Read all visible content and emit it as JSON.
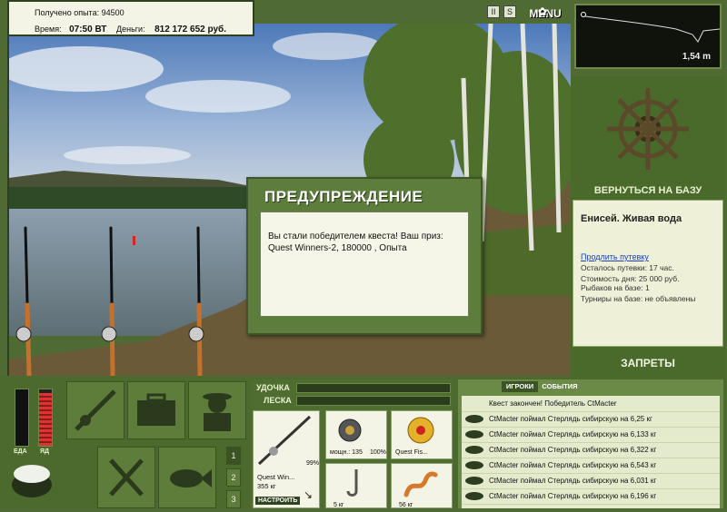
{
  "stats": {
    "xp_label": "Получено опыта:",
    "xp_value": "94500",
    "time_label": "Время:",
    "time_value": "07:50 ВТ",
    "money_label": "Деньги:",
    "money_value": "812 172 652 руб."
  },
  "topbar": {
    "pause_glyph": "II",
    "sound_glyph": "S",
    "menu_label": "MENU"
  },
  "depth": {
    "value": "1,54 m"
  },
  "right_panel": {
    "return_label": "ВЕРНУТЬСЯ НА БАЗУ",
    "location": "Енисей. Живая вода",
    "extend_link": "Продлить путевку",
    "info_lines": [
      "Осталось путевки: 17 час.",
      "Стоимость дня: 25 000 руб.",
      "Рыбаков на базе: 1",
      "Турниры на базе: не объявлены"
    ],
    "bans_label": "ЗАПРЕТЫ"
  },
  "dialog": {
    "title": "ПРЕДУПРЕЖДЕНИЕ",
    "message": "Вы стали победителем квеста! Ваш приз: Quest Winners-2, 180000 , Опыта"
  },
  "meters": {
    "food_label": "ЕДА",
    "poison_label": "ЯД"
  },
  "pages": [
    "1",
    "2",
    "3"
  ],
  "rod_panel": {
    "rod_label": "УДОЧКА",
    "line_label": "ЛЕСКА",
    "rod_name": "Quest Win...",
    "rod_weight": "355 кг",
    "rod_pct": "99%",
    "setup_label": "НАСТРОИТЬ",
    "reel_caption": "мощн.: 135",
    "reel_pct": "100%",
    "line_caption": "Quest Fis...",
    "hook_caption": "5 кг",
    "bait_caption": "56 кг"
  },
  "events": {
    "tab_players": "ИГРОКИ",
    "tab_events": "СОБЫТИЯ",
    "quest_done": "Квест закончен! Победитель CtMacter",
    "catches": [
      "CtMacter поймал Стерлядь сибирскую на 6,25 кг",
      "CtMacter поймал Стерлядь сибирскую на 6,133 кг",
      "CtMacter поймал Стерлядь сибирскую на 6,322 кг",
      "CtMacter поймал Стерлядь сибирскую на 6,543 кг",
      "CtMacter поймал Стерлядь сибирскую на 6,031 кг",
      "CtMacter поймал Стерлядь сибирскую на 6,196 кг"
    ]
  },
  "colors": {
    "panel": "#4c6a2e",
    "accent": "#e8f0d0",
    "scene_sky": "#5a86c4"
  }
}
